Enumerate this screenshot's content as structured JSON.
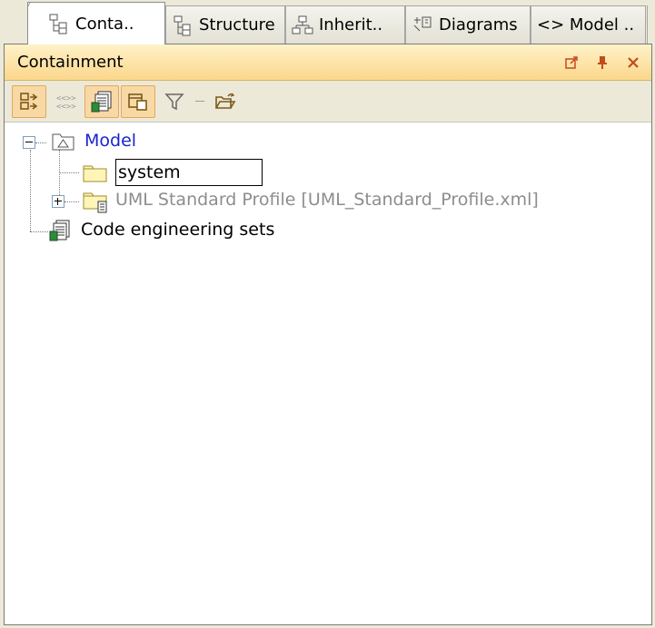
{
  "tabs": [
    {
      "label": "Conta..",
      "icon": "containment-tree-icon",
      "active": true
    },
    {
      "label": "Structure",
      "icon": "structure-tree-icon",
      "active": false
    },
    {
      "label": "Inherit..",
      "icon": "inheritance-tree-icon",
      "active": false
    },
    {
      "label": "Diagrams",
      "icon": "diagrams-icon",
      "active": false
    },
    {
      "label": "<> Model ..",
      "icon": "",
      "active": false
    }
  ],
  "panel": {
    "title": "Containment",
    "controls": [
      "undock-icon",
      "pin-icon",
      "close-icon"
    ]
  },
  "toolbar": {
    "buttons": [
      {
        "icon": "group-by-icon",
        "pressed": true
      },
      {
        "icon": "show-elements-icon",
        "pressed": false
      },
      {
        "icon": "code-engineering-icon",
        "pressed": true
      },
      {
        "icon": "show-diagrams-icon",
        "pressed": true
      },
      {
        "icon": "filter-icon",
        "pressed": false
      },
      {
        "icon": "open-folder-icon",
        "pressed": false
      }
    ]
  },
  "tree": {
    "root": {
      "label": "Model",
      "icon": "model-package-icon",
      "expanded": true
    },
    "editing": {
      "value": "system",
      "icon": "folder-icon"
    },
    "uml_profile": {
      "label": "UML Standard Profile [UML_Standard_Profile.xml]",
      "icon": "profile-folder-icon",
      "expanded": false
    },
    "code_sets": {
      "label": "Code engineering sets",
      "icon": "code-engineering-sets-icon"
    }
  },
  "colors": {
    "model_label": "#1a24d1",
    "disabled_label": "#8d8d8d",
    "titlebar_bg": "#fbd78c",
    "pressed_button": "#f8d9a5"
  }
}
